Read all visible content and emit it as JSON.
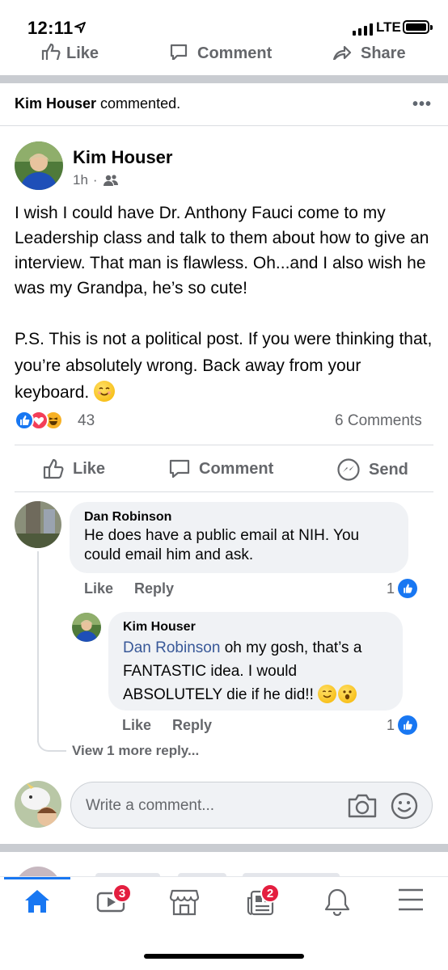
{
  "status_bar": {
    "time": "12:11",
    "network": "LTE"
  },
  "previous_post_actions": {
    "like": "Like",
    "comment": "Comment",
    "share": "Share"
  },
  "activity": {
    "actor": "Kim Houser",
    "verb": "commented."
  },
  "post": {
    "author": "Kim Houser",
    "time": "1h",
    "separator": "·",
    "audience_icon": "friends-icon",
    "paragraph1": "I wish I could have Dr. Anthony Fauci come to my Leadership class and talk to them about how to give an interview. That man is flawless. Oh...and I also wish he was my Grandpa, he’s so cute!",
    "paragraph2": "P.S. This is not a political post. If you were thinking that, you’re absolutely wrong. Back away from your keyboard.",
    "reaction_count": "43",
    "comments_count": "6 Comments",
    "actions": {
      "like": "Like",
      "comment": "Comment",
      "send": "Send"
    }
  },
  "comments": [
    {
      "author": "Dan Robinson",
      "text": "He does have a public email at NIH.  You could email him and ask.",
      "like_label": "Like",
      "reply_label": "Reply",
      "like_count": "1",
      "reply": {
        "author": "Kim Houser",
        "mention": "Dan Robinson",
        "text": " oh my gosh, that’s a FANTASTIC idea. I would ABSOLUTELY die if he did!!",
        "like_label": "Like",
        "reply_label": "Reply",
        "like_count": "1"
      },
      "view_more": "View 1 more reply..."
    }
  ],
  "composer": {
    "placeholder": "Write a comment..."
  },
  "tab_bar": {
    "tabs": [
      {
        "name": "home",
        "icon": "home-icon",
        "active": true
      },
      {
        "name": "watch",
        "icon": "video-icon",
        "badge": "3"
      },
      {
        "name": "marketplace",
        "icon": "store-icon"
      },
      {
        "name": "news",
        "icon": "news-icon",
        "badge": "2"
      },
      {
        "name": "notifications",
        "icon": "bell-icon"
      },
      {
        "name": "menu",
        "icon": "menu-icon"
      }
    ]
  },
  "colors": {
    "brand_blue": "#1877f2",
    "secondary_text": "#65676b",
    "bubble_bg": "#f0f2f5",
    "badge_red": "#e41e3f"
  }
}
